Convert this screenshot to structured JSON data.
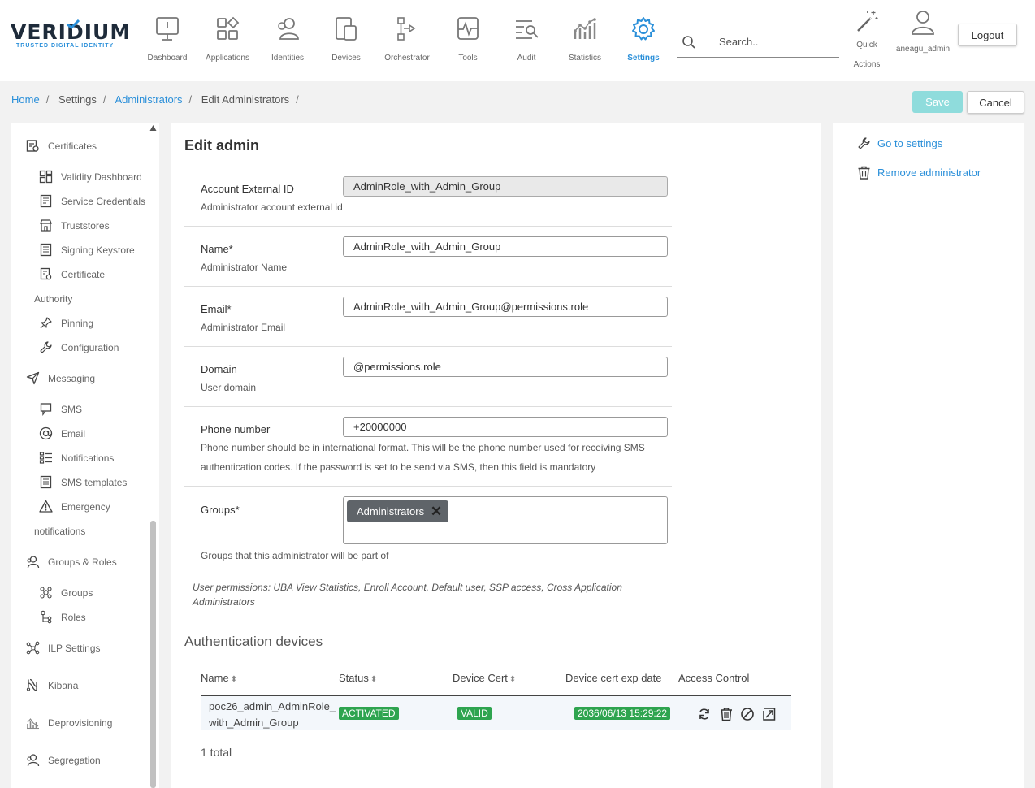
{
  "brand": {
    "name": "VERIDIUM",
    "tagline": "TRUSTED DIGITAL IDENTITY",
    "accent": "#2a8fd9"
  },
  "nav": [
    {
      "label": "Dashboard",
      "icon": "monitor-icon"
    },
    {
      "label": "Applications",
      "icon": "apps-grid-icon"
    },
    {
      "label": "Identities",
      "icon": "identities-icon"
    },
    {
      "label": "Devices",
      "icon": "devices-icon"
    },
    {
      "label": "Orchestrator",
      "icon": "orchestrator-icon"
    },
    {
      "label": "Tools",
      "icon": "tools-icon"
    },
    {
      "label": "Audit",
      "icon": "audit-icon"
    },
    {
      "label": "Statistics",
      "icon": "statistics-icon"
    },
    {
      "label": "Settings",
      "icon": "gear-icon",
      "active": true
    }
  ],
  "search": {
    "placeholder": "Search.."
  },
  "quick_actions": {
    "label": "Quick Actions"
  },
  "user": {
    "name": "aneagu_admin"
  },
  "logout_label": "Logout",
  "breadcrumbs": [
    "Home",
    "Settings",
    "Administrators",
    "Edit Administrators"
  ],
  "toolbar": {
    "save_label": "Save",
    "cancel_label": "Cancel"
  },
  "sidebar": {
    "certificates": "Certificates",
    "validity_dashboard": "Validity Dashboard",
    "service_credentials": "Service Credentials",
    "truststores": "Truststores",
    "signing_keystore": "Signing Keystore",
    "certificate": "Certificate",
    "authority": "Authority",
    "pinning": "Pinning",
    "configuration": "Configuration",
    "messaging": "Messaging",
    "sms": "SMS",
    "email": "Email",
    "notifications": "Notifications",
    "sms_templates": "SMS templates",
    "emergency": "Emergency",
    "notifications2": "notifications",
    "groups_roles": "Groups & Roles",
    "groups": "Groups",
    "roles": "Roles",
    "ilp_settings": "ILP Settings",
    "kibana": "Kibana",
    "deprovisioning": "Deprovisioning",
    "segregation": "Segregation"
  },
  "form": {
    "title": "Edit admin",
    "external_id": {
      "label": "Account External ID",
      "help": "Administrator account external id",
      "value": "AdminRole_with_Admin_Group"
    },
    "name": {
      "label": "Name*",
      "help": "Administrator Name",
      "value": "AdminRole_with_Admin_Group"
    },
    "email": {
      "label": "Email*",
      "help": "Administrator Email",
      "value": "AdminRole_with_Admin_Group@permissions.role"
    },
    "domain": {
      "label": "Domain",
      "help": "User domain",
      "value": "@permissions.role"
    },
    "phone": {
      "label": "Phone number",
      "help1": "Phone number should be in international format. This will be the phone number used for receiving SMS",
      "help2": "authentication codes. If the password is set to be send via SMS, then this field is mandatory",
      "value": "+20000000"
    },
    "groups": {
      "label": "Groups*",
      "help": "Groups that this administrator will be part of",
      "chip": "Administrators"
    },
    "permissions_line1": "User permissions: UBA View Statistics, Enroll Account, Default user, SSP access, Cross Application",
    "permissions_line2": "Administrators"
  },
  "devices": {
    "title": "Authentication devices",
    "columns": {
      "name": "Name",
      "status": "Status",
      "device_cert": "Device Cert",
      "exp_date": "Device cert exp date",
      "access": "Access Control"
    },
    "row": {
      "name1": "poc26_admin_AdminRole_",
      "name2": "with_Admin_Group",
      "status": "ACTIVATED",
      "cert": "VALID",
      "exp": "2036/06/13 15:29:22"
    },
    "total": "1 total"
  },
  "right_panel": {
    "go_settings": "Go to settings",
    "remove_admin": "Remove administrator"
  }
}
